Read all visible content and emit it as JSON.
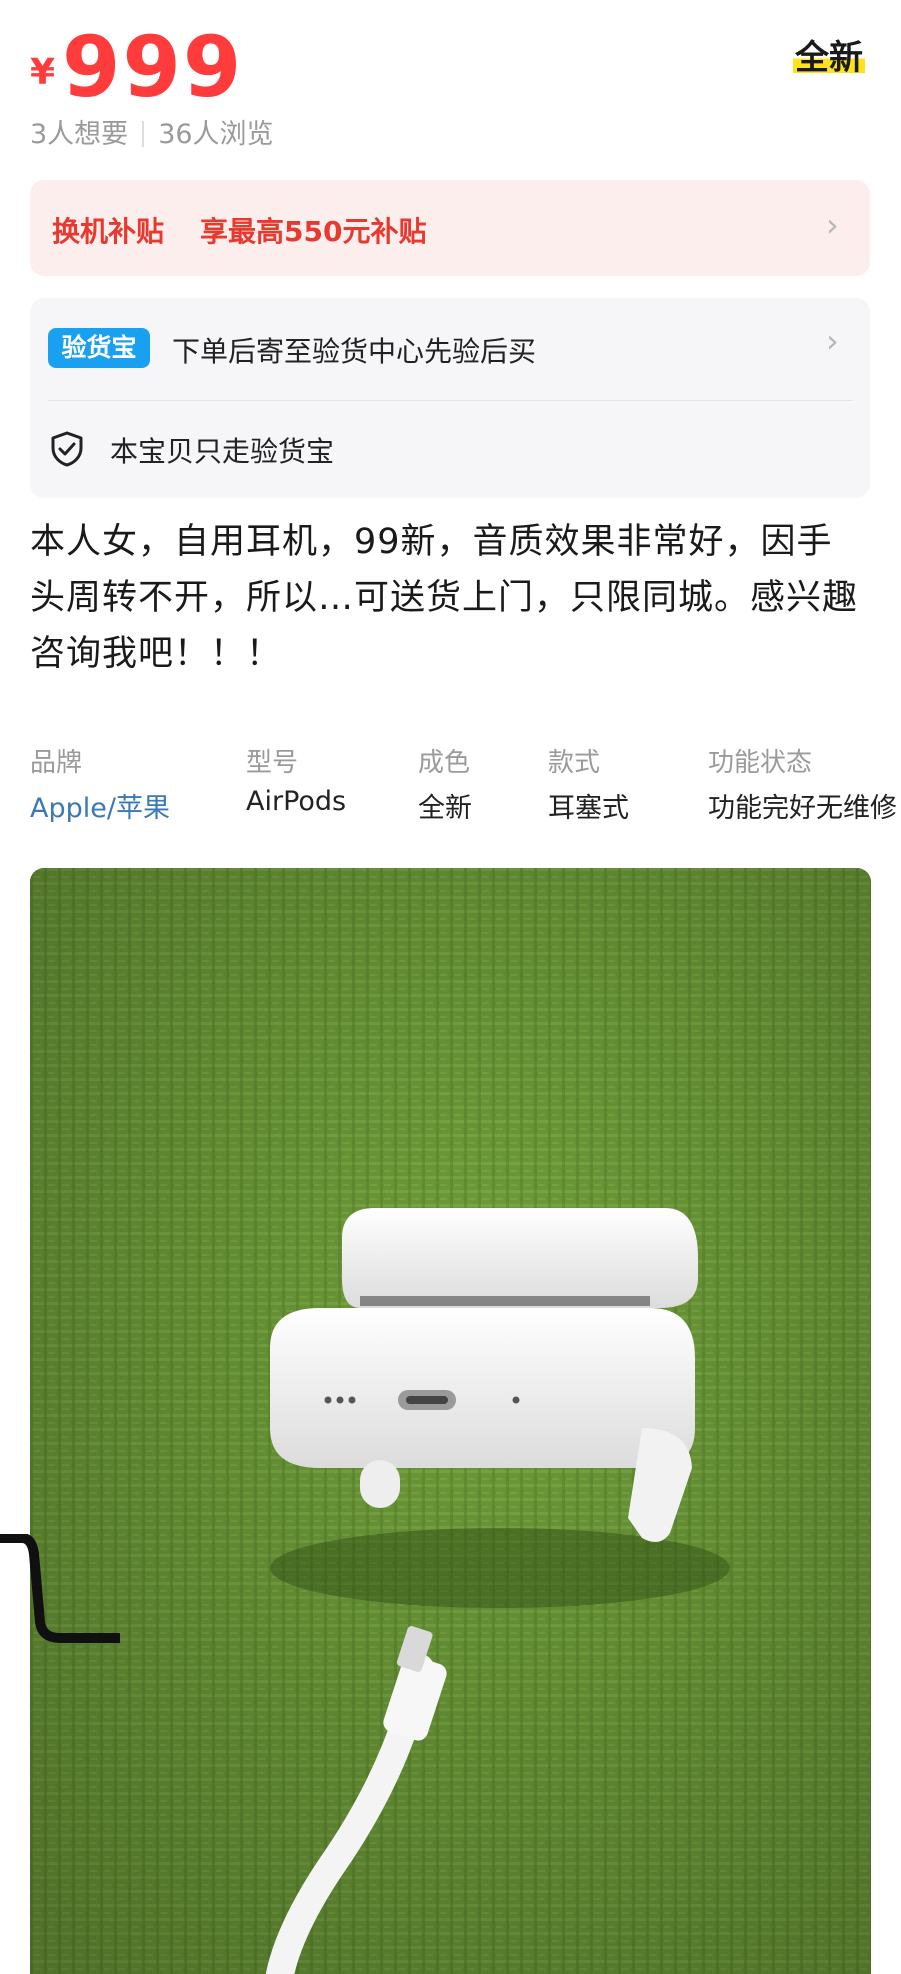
{
  "price": {
    "symbol": "¥",
    "value": "999"
  },
  "condition_badge": "全新",
  "stats": {
    "wants": "3人想要",
    "views": "36人浏览"
  },
  "subsidy": {
    "title": "换机补贴",
    "text": "享最高550元补贴"
  },
  "inspection": {
    "logo_text": "验货宝",
    "text": "下单后寄至验货中心先验后买",
    "guarantee_text": "本宝贝只走验货宝"
  },
  "description": "本人女，自用耳机，99新，音质效果非常好，因手头周转不开，所以…可送货上门，只限同城。感兴趣咨询我吧！！！",
  "specs": [
    {
      "label": "品牌",
      "value": "Apple/苹果"
    },
    {
      "label": "型号",
      "value": "AirPods"
    },
    {
      "label": "成色",
      "value": "全新"
    },
    {
      "label": "款式",
      "value": "耳塞式"
    },
    {
      "label": "功能状态",
      "value": "功能完好无维修"
    }
  ],
  "colors": {
    "price": "#ff3b3b",
    "subsidy_bg": "#fdeeee",
    "link": "#3b78b5",
    "badge_highlight": "#ffe21a"
  },
  "icons": [
    "chevron-right-icon",
    "shield-check-icon"
  ]
}
